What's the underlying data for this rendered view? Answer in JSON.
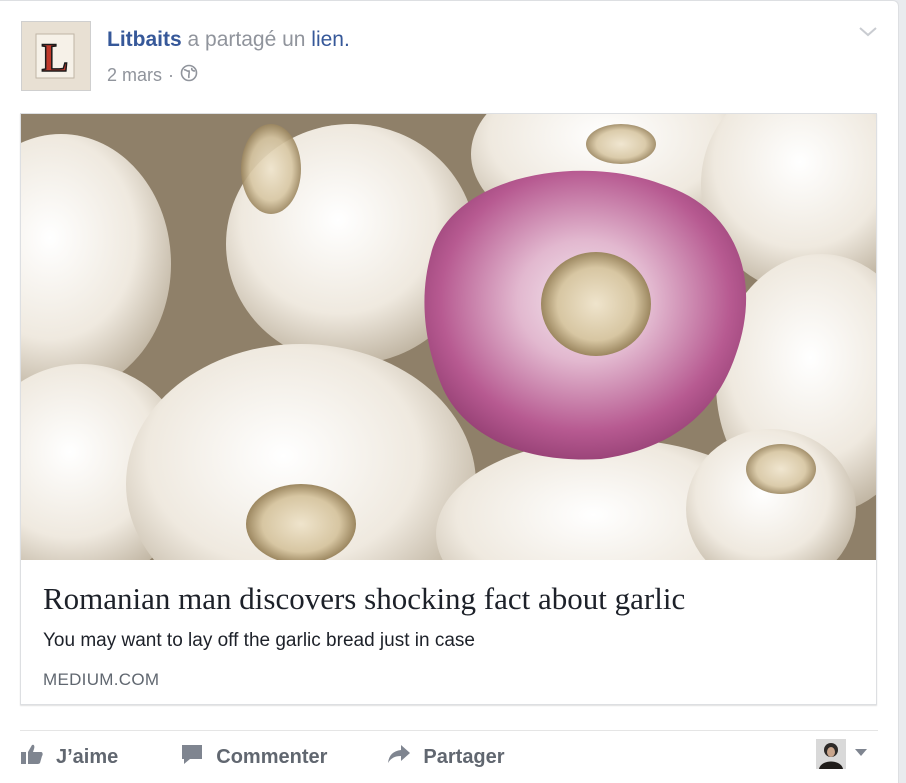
{
  "post": {
    "author": "Litbaits",
    "action_text": " a partagé un ",
    "object_text": "lien.",
    "date": "2 mars",
    "separator": "·",
    "privacy_icon": "globe-icon",
    "avatar_letter": "L",
    "options_icon": "chevron-down-icon"
  },
  "link": {
    "image_subject": "garlic",
    "title": "Romanian man discovers shocking fact about garlic",
    "description": "You may want to lay off the garlic bread just in case",
    "domain": "MEDIUM.COM"
  },
  "actions": {
    "like": "J’aime",
    "comment": "Commenter",
    "share": "Partager",
    "like_icon": "thumbs-up-icon",
    "comment_icon": "speech-bubble-icon",
    "share_icon": "share-arrow-icon"
  },
  "colors": {
    "link_blue": "#365899",
    "meta_gray": "#90949c",
    "action_gray": "#616770",
    "title_black": "#1d2129"
  }
}
